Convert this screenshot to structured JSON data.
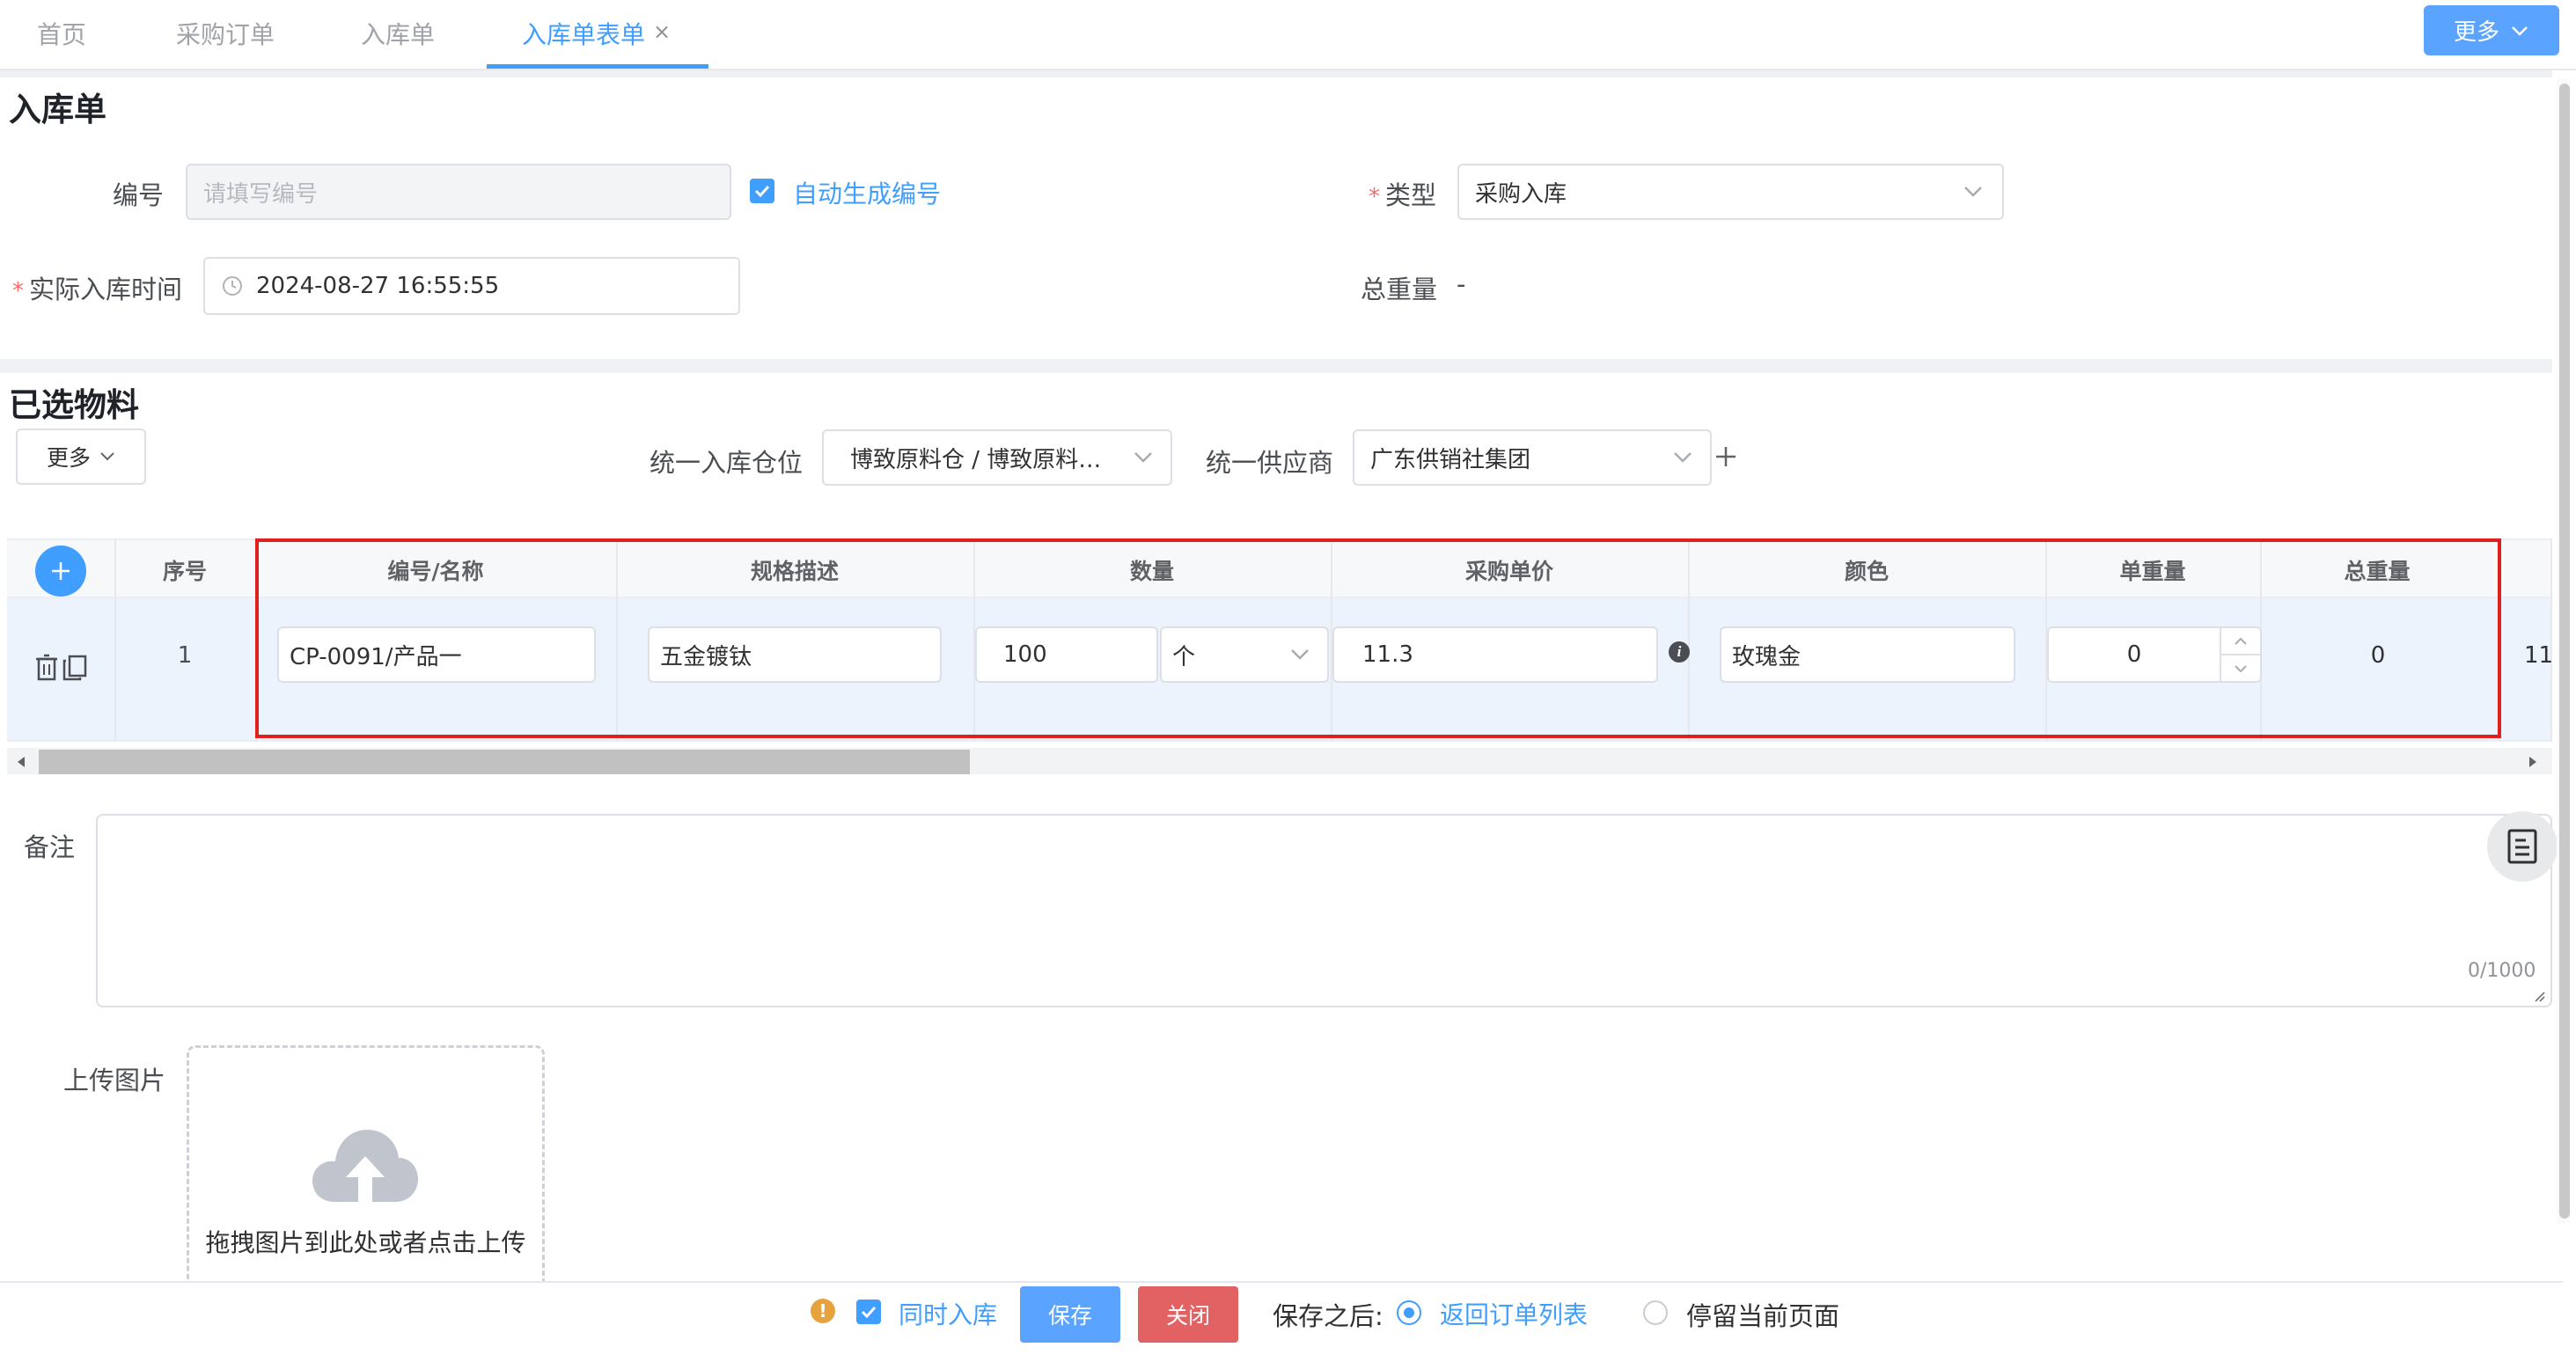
{
  "tabs": [
    "首页",
    "采购订单",
    "入库单",
    "入库单表单"
  ],
  "top_more": "更多",
  "form": {
    "title": "入库单",
    "code_label": "编号",
    "code_placeholder": "请填写编号",
    "auto_code_label": "自动生成编号",
    "type_label": "类型",
    "type_value": "采购入库",
    "time_label": "实际入库时间",
    "time_value": "2024-08-27 16:55:55",
    "total_weight_label": "总重量",
    "total_weight_value": "-"
  },
  "materials": {
    "title": "已选物料",
    "more_button": "更多",
    "warehouse_label": "统一入库仓位",
    "warehouse_value": "博致原料仓 / 博致原料…",
    "supplier_label": "统一供应商",
    "supplier_value": "广东供销社集团",
    "columns": [
      "序号",
      "编号/名称",
      "规格描述",
      "数量",
      "采购单价",
      "颜色",
      "单重量",
      "总重量"
    ],
    "row": {
      "index": "1",
      "code_name": "CP-0091/产品一",
      "spec": "五金镀钛",
      "quantity": "100",
      "unit": "个",
      "price": "11.3",
      "color": "玫瑰金",
      "unit_weight": "0",
      "total_weight": "0",
      "overflow": "11"
    }
  },
  "remarks": {
    "label": "备注",
    "counter": "0/1000"
  },
  "upload": {
    "label": "上传图片",
    "hint": "拖拽图片到此处或者点击上传"
  },
  "footer": {
    "sync_label": "同时入库",
    "save": "保存",
    "close": "关闭",
    "after_save_label": "保存之后:",
    "option_return": "返回订单列表",
    "option_stay": "停留当前页面"
  },
  "colors": {
    "primary": "#409eff",
    "danger": "#e26264",
    "highlight_border": "#e0201f"
  }
}
